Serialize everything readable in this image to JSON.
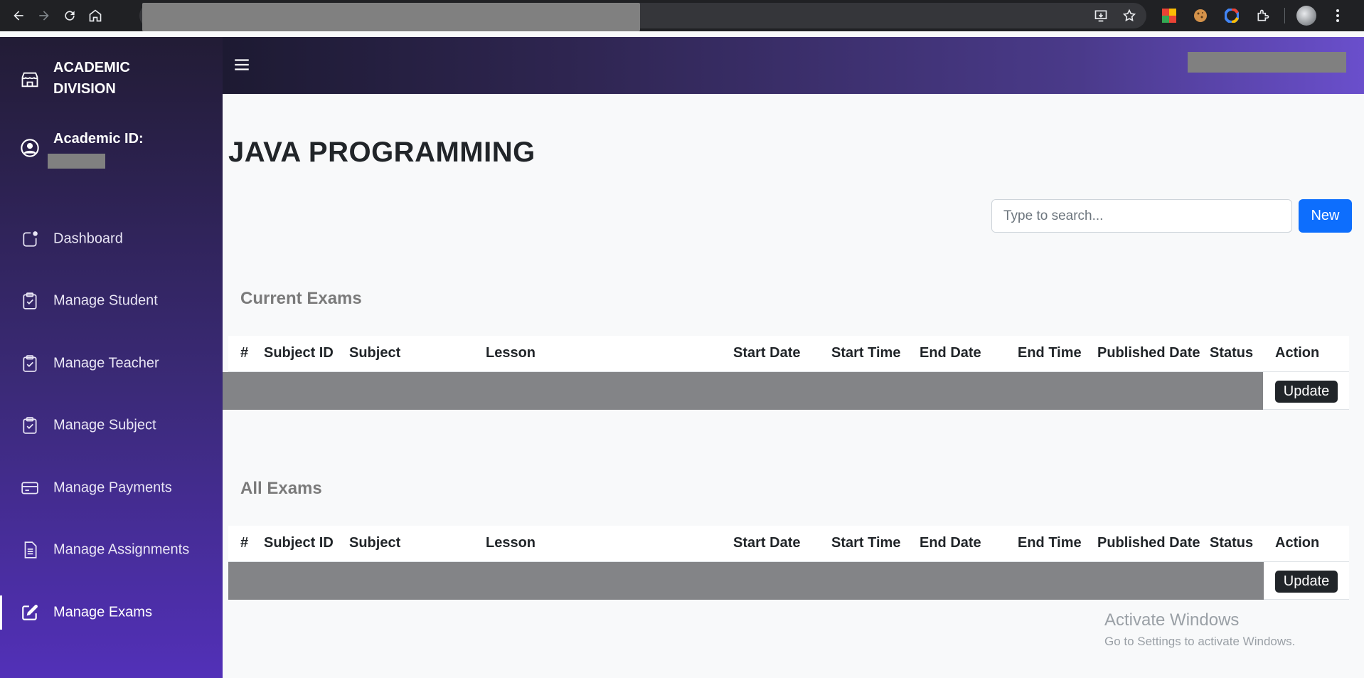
{
  "browser": {
    "back_icon": "arrow-left-icon",
    "forward_icon": "arrow-right-icon",
    "reload_icon": "reload-icon",
    "home_icon": "home-icon",
    "url_redacted": true
  },
  "sidebar": {
    "brand": "ACADEMIC DIVISION",
    "academic_id_label": "Academic ID:",
    "items": [
      {
        "label": "Dashboard",
        "icon": "dashboard-icon",
        "active": false
      },
      {
        "label": "Manage Student",
        "icon": "clipboard-check-icon",
        "active": false
      },
      {
        "label": "Manage Teacher",
        "icon": "clipboard-check-icon",
        "active": false
      },
      {
        "label": "Manage Subject",
        "icon": "clipboard-check-icon",
        "active": false
      },
      {
        "label": "Manage Payments",
        "icon": "credit-card-icon",
        "active": false
      },
      {
        "label": "Manage Assignments",
        "icon": "document-icon",
        "active": false
      },
      {
        "label": "Manage Exams",
        "icon": "edit-icon",
        "active": true
      }
    ]
  },
  "main": {
    "title": "JAVA PROGRAMMING",
    "search_placeholder": "Type to search...",
    "new_label": "New",
    "current_title": "Current Exams",
    "all_title": "All Exams",
    "columns": [
      "#",
      "Subject ID",
      "Subject",
      "Lesson",
      "Start Date",
      "Start Time",
      "End Date",
      "End Time",
      "Published Date",
      "Status",
      "Action"
    ],
    "update_label": "Update"
  },
  "watermark": {
    "line1": "Activate Windows",
    "line2": "Go to Settings to activate Windows."
  },
  "colors": {
    "primary": "#0d6efd",
    "dark_button": "#212529",
    "sidebar_top": "#221c35",
    "sidebar_bottom": "#5230b8"
  }
}
